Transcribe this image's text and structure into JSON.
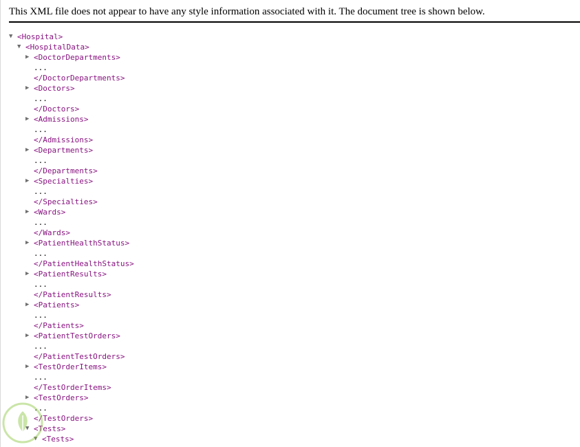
{
  "header": {
    "message": "This XML file does not appear to have any style information associated with it. The document tree is shown below."
  },
  "tree": {
    "root_open": "<Hospital>",
    "data_open": "<HospitalData>",
    "nodes": [
      {
        "open": "<DoctorDepartments>",
        "ellipsis": "...",
        "close": "</DoctorDepartments>"
      },
      {
        "open": "<Doctors>",
        "ellipsis": "...",
        "close": "</Doctors>"
      },
      {
        "open": "<Admissions>",
        "ellipsis": "...",
        "close": "</Admissions>"
      },
      {
        "open": "<Departments>",
        "ellipsis": "...",
        "close": "</Departments>"
      },
      {
        "open": "<Specialties>",
        "ellipsis": "...",
        "close": "</Specialties>"
      },
      {
        "open": "<Wards>",
        "ellipsis": "...",
        "close": "</Wards>"
      },
      {
        "open": "<PatientHealthStatus>",
        "ellipsis": "...",
        "close": "</PatientHealthStatus>"
      },
      {
        "open": "<PatientResults>",
        "ellipsis": "...",
        "close": "</PatientResults>"
      },
      {
        "open": "<Patients>",
        "ellipsis": "...",
        "close": "</Patients>"
      },
      {
        "open": "<PatientTestOrders>",
        "ellipsis": "...",
        "close": "</PatientTestOrders>"
      },
      {
        "open": "<TestOrderItems>",
        "ellipsis": "...",
        "close": "</TestOrderItems>"
      },
      {
        "open": "<TestOrders>",
        "ellipsis": "...",
        "close": "</TestOrders>"
      }
    ],
    "tests_open": "<Tests>",
    "tests_inner_open": "<Tests>"
  },
  "icons": {
    "expanded": "triangle-down-icon",
    "collapsed": "triangle-right-icon"
  },
  "colors": {
    "tag": "#881280",
    "toggle": "#6e6e6e"
  }
}
